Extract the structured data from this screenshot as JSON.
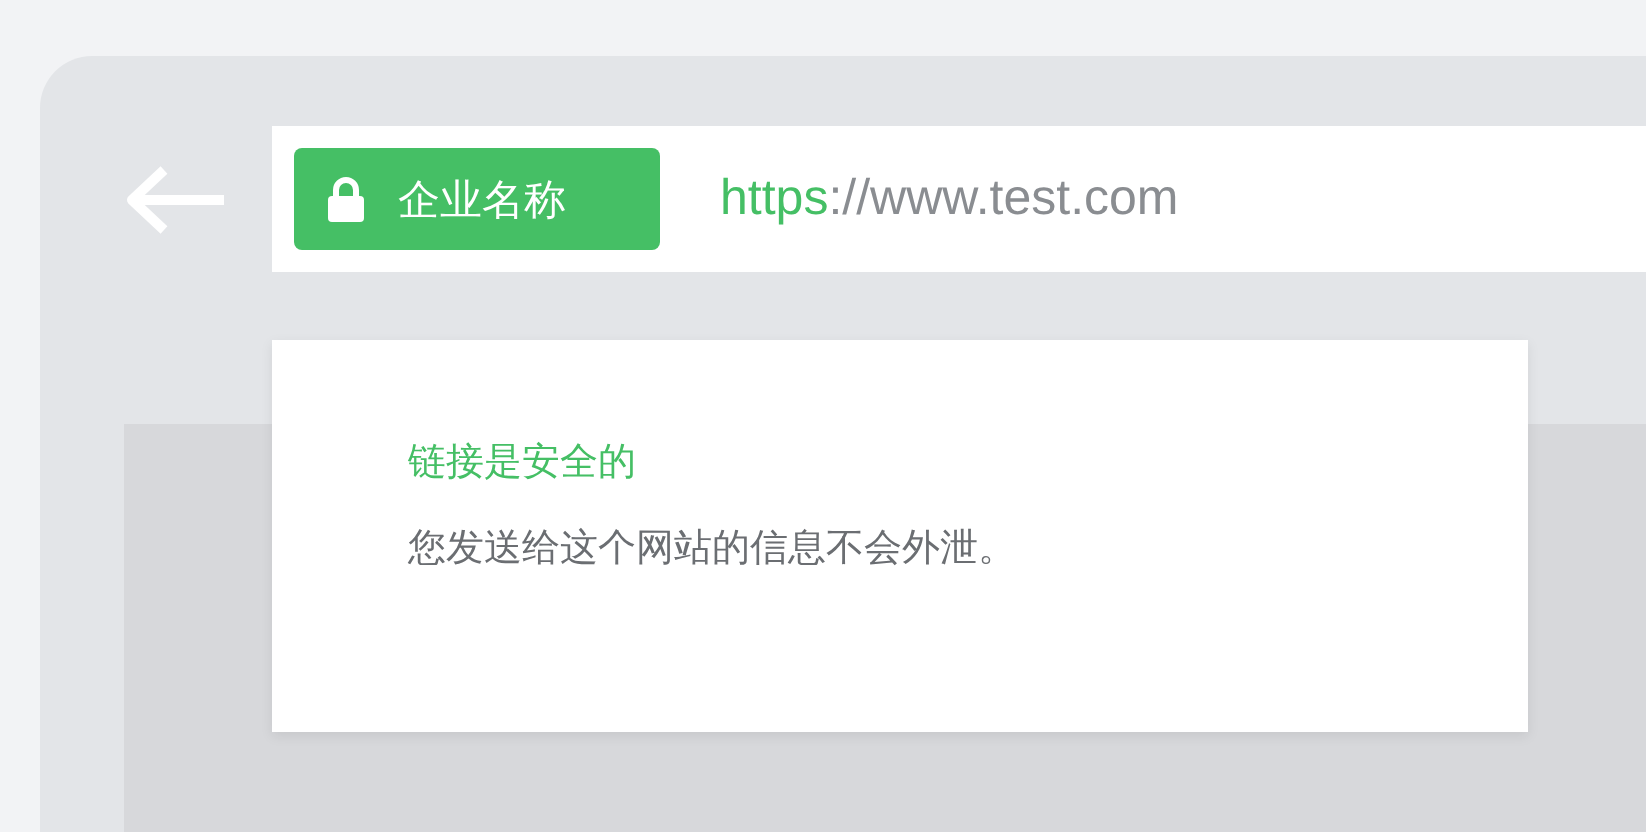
{
  "address_bar": {
    "badge": {
      "label": "企业名称"
    },
    "url": {
      "scheme": "https",
      "rest": "://www.test.com"
    }
  },
  "popup": {
    "title": "链接是安全的",
    "message": "您发送给这个网站的信息不会外泄。"
  }
}
